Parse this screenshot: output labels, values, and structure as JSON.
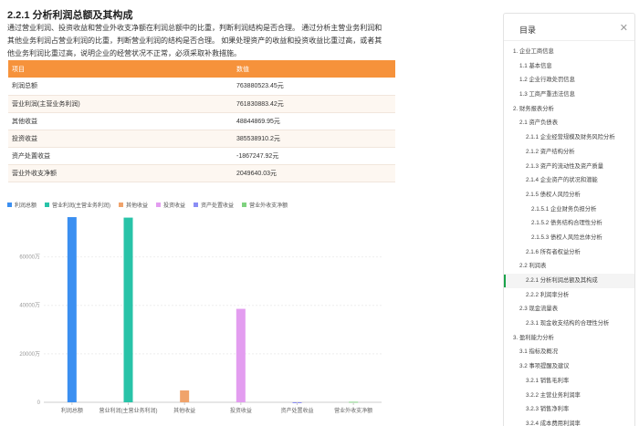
{
  "report": {
    "section_title": "2.2.1 分析利润总额及其构成",
    "description": "通过营业利润、投资收益和营业外收支净额在利润总额中的比重，判断利润结构是否合理。 通过分析主营业务利润和其他业务利润占营业利润的比重，判断营业利润的结构是否合理。 如果处理资产的收益和投资收益比重过高，或者其他业务利润比重过高，说明企业的经营状况不正常，必须采取补救措施。",
    "table": {
      "headers": [
        "项目",
        "数值"
      ],
      "rows": [
        {
          "item": "利润总额",
          "value": "763880523.45元"
        },
        {
          "item": "营业利润(主营业务利润)",
          "value": "761830883.42元"
        },
        {
          "item": "其他收益",
          "value": "48844869.95元"
        },
        {
          "item": "投资收益",
          "value": "385538910.2元"
        },
        {
          "item": "资产处置收益",
          "value": "-1867247.92元"
        },
        {
          "item": "营业外收支净额",
          "value": "2049640.03元"
        }
      ]
    }
  },
  "chart_data": {
    "type": "bar",
    "categories": [
      "利润总额",
      "营业利润(主营业务利润)",
      "其他收益",
      "投资收益",
      "资产处置收益",
      "营业外收支净额"
    ],
    "values": [
      76388.05,
      76183.09,
      4884.49,
      38553.89,
      -186.72,
      204.96
    ],
    "colors": [
      "#3b8ff1",
      "#28c3a8",
      "#f0a36b",
      "#e39df0",
      "#8a8df5",
      "#7fd27f"
    ],
    "y_ticks": [
      {
        "value": 0,
        "label": "0"
      },
      {
        "value": 20000,
        "label": "20000万"
      },
      {
        "value": 40000,
        "label": "40000万"
      },
      {
        "value": 60000,
        "label": "60000万"
      }
    ],
    "ylim": [
      -1000,
      80000
    ],
    "legend": [
      "利润总额",
      "营业利润(主营业务利润)",
      "其他收益",
      "投资收益",
      "资产处置收益",
      "营业外收支净额"
    ],
    "legend_position": "top-left",
    "grid": true
  },
  "toc": {
    "title": "目录",
    "close_icon": "close-icon",
    "active_color": "#1aa34a",
    "items": [
      {
        "label": "1. 企业工商信息",
        "level": 0
      },
      {
        "label": "1.1 基本信息",
        "level": 1
      },
      {
        "label": "1.2 企业行政处罚信息",
        "level": 1
      },
      {
        "label": "1.3 工商严重违法信息",
        "level": 1
      },
      {
        "label": "2. 财务报表分析",
        "level": 0
      },
      {
        "label": "2.1 资产负债表",
        "level": 1
      },
      {
        "label": "2.1.1 企业经营规模及财务风险分析",
        "level": 2
      },
      {
        "label": "2.1.2 资产结构分析",
        "level": 2
      },
      {
        "label": "2.1.3 资产的流动性及资产质量",
        "level": 2
      },
      {
        "label": "2.1.4 企业资产的状况和潜能",
        "level": 2
      },
      {
        "label": "2.1.5 债权人风险分析",
        "level": 2
      },
      {
        "label": "2.1.5.1 企业财务负担分析",
        "level": 3
      },
      {
        "label": "2.1.5.2 债务结构合理性分析",
        "level": 3
      },
      {
        "label": "2.1.5.3 债权人风险总体分析",
        "level": 3
      },
      {
        "label": "2.1.6 所有者权益分析",
        "level": 2
      },
      {
        "label": "2.2 利润表",
        "level": 1
      },
      {
        "label": "2.2.1 分析利润总额及其构成",
        "level": 2,
        "active": true
      },
      {
        "label": "2.2.2 利润率分析",
        "level": 2
      },
      {
        "label": "2.3 现金流量表",
        "level": 1
      },
      {
        "label": "2.3.1 现金收支结构的合理性分析",
        "level": 2
      },
      {
        "label": "3. 盈利能力分析",
        "level": 0
      },
      {
        "label": "3.1 指标及概况",
        "level": 1
      },
      {
        "label": "3.2 事项提醒及建议",
        "level": 1
      },
      {
        "label": "3.2.1 销售毛利率",
        "level": 2
      },
      {
        "label": "3.2.2 主营业务利润率",
        "level": 2
      },
      {
        "label": "3.2.3 销售净利率",
        "level": 2
      },
      {
        "label": "3.2.4 成本费用利润率",
        "level": 2
      }
    ]
  }
}
